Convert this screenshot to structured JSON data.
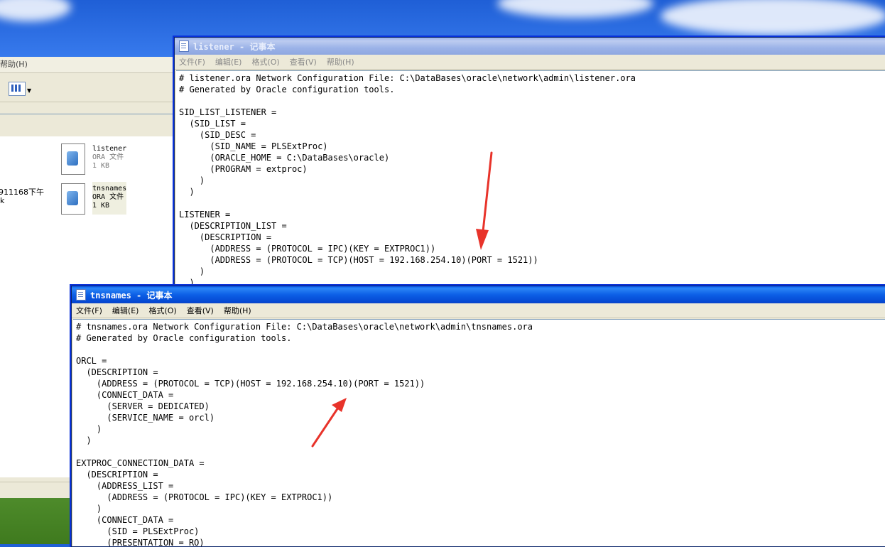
{
  "explorer": {
    "menu_partial": "帮助(H)",
    "files": [
      {
        "name": "listener",
        "type": "ORA 文件",
        "size": "1 KB"
      },
      {
        "name": "tnsnames",
        "type": "ORA 文件",
        "size": "1 KB"
      }
    ],
    "edge_text_1": "911168下午",
    "edge_text_2": "k"
  },
  "listener_window": {
    "title": "listener - 记事本",
    "menu": [
      "文件(F)",
      "编辑(E)",
      "格式(O)",
      "查看(V)",
      "帮助(H)"
    ],
    "content": "# listener.ora Network Configuration File: C:\\DataBases\\oracle\\network\\admin\\listener.ora\n# Generated by Oracle configuration tools.\n\nSID_LIST_LISTENER =\n  (SID_LIST =\n    (SID_DESC =\n      (SID_NAME = PLSExtProc)\n      (ORACLE_HOME = C:\\DataBases\\oracle)\n      (PROGRAM = extproc)\n    )\n  )\n\nLISTENER =\n  (DESCRIPTION_LIST =\n    (DESCRIPTION =\n      (ADDRESS = (PROTOCOL = IPC)(KEY = EXTPROC1))\n      (ADDRESS = (PROTOCOL = TCP)(HOST = 192.168.254.10)(PORT = 1521))\n    )\n  )"
  },
  "tnsnames_window": {
    "title": "tnsnames - 记事本",
    "menu": [
      "文件(F)",
      "编辑(E)",
      "格式(O)",
      "查看(V)",
      "帮助(H)"
    ],
    "content": "# tnsnames.ora Network Configuration File: C:\\DataBases\\oracle\\network\\admin\\tnsnames.ora\n# Generated by Oracle configuration tools.\n\nORCL =\n  (DESCRIPTION =\n    (ADDRESS = (PROTOCOL = TCP)(HOST = 192.168.254.10)(PORT = 1521))\n    (CONNECT_DATA =\n      (SERVER = DEDICATED)\n      (SERVICE_NAME = orcl)\n    )\n  )\n\nEXTPROC_CONNECTION_DATA =\n  (DESCRIPTION =\n    (ADDRESS_LIST =\n      (ADDRESS = (PROTOCOL = IPC)(KEY = EXTPROC1))\n    )\n    (CONNECT_DATA =\n      (SID = PLSExtProc)\n      (PRESENTATION = RO)\n    )\n  )"
  },
  "colors": {
    "titlebar_active": "#0c5fe6",
    "titlebar_inactive": "#9cb3e8",
    "annotation_arrow": "#e8332a"
  }
}
